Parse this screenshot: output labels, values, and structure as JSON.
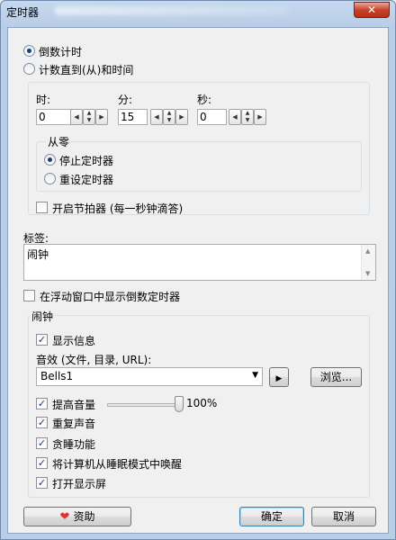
{
  "window": {
    "title": "定时器",
    "close_glyph": "✕"
  },
  "mode": {
    "countdown_label": "倒数计时",
    "count_to_label": "计数直到(从)和时间",
    "selected": "countdown"
  },
  "time": {
    "hours_label": "时:",
    "hours_value": "0",
    "minutes_label": "分:",
    "minutes_value": "15",
    "seconds_label": "秒:",
    "seconds_value": "0"
  },
  "from_zero": {
    "label": "从零",
    "stop_label": "停止定时器",
    "reset_label": "重设定时器",
    "selected": "stop"
  },
  "metronome_label": "开启节拍器 (每一秒钟滴答)",
  "tag": {
    "label": "标签:",
    "value": "闹钟"
  },
  "float_window_label": "在浮动窗口中显示倒数定时器",
  "alarm": {
    "label": "闹钟",
    "show_message_label": "显示信息",
    "sound_label": "音效 (文件, 目录, URL):",
    "sound_value": "Bells1",
    "browse_label": "浏览...",
    "raise_volume_label": "提高音量",
    "volume_text": "100%",
    "volume_fraction": 1.0,
    "repeat_label": "重复声音",
    "snooze_label": "贪睡功能",
    "wake_label": "将计算机从睡眠模式中唤醒",
    "display_on_label": "打开显示屏"
  },
  "buttons": {
    "donate": "资助",
    "ok": "确定",
    "cancel": "取消"
  },
  "check_glyph": "✓",
  "colors": {
    "accent": "#1c3c78",
    "heart": "#e0303a"
  }
}
